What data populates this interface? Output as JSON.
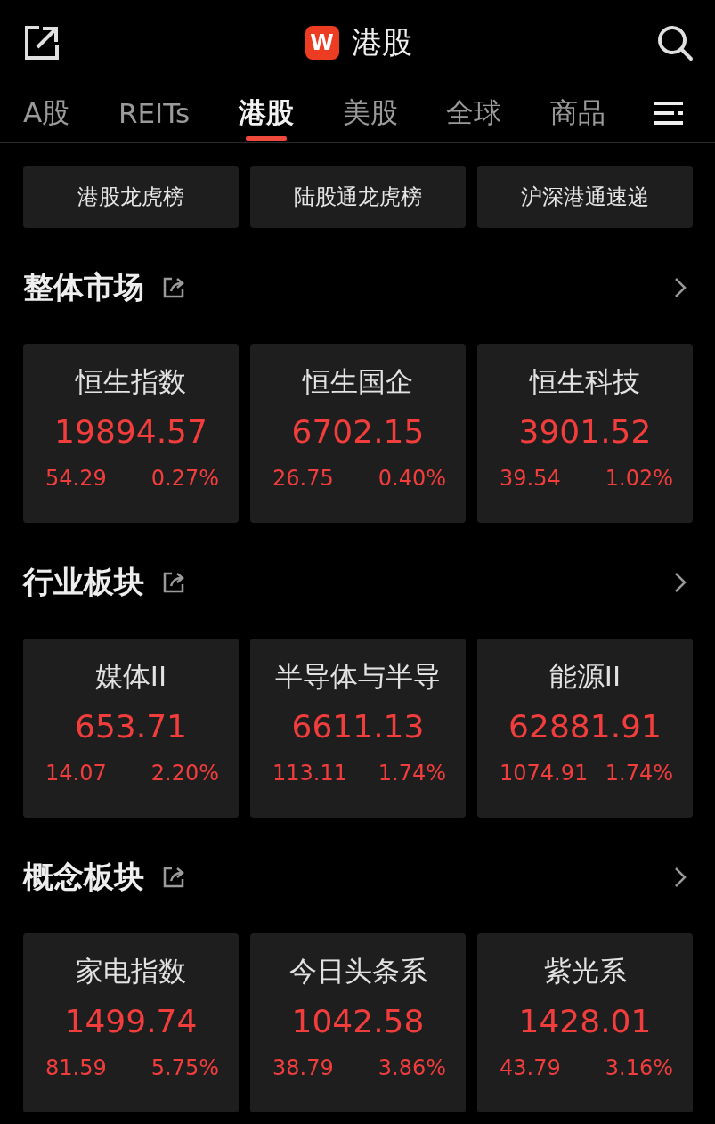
{
  "header": {
    "logo": "W",
    "title": "港股"
  },
  "tabs": [
    {
      "label": "A股",
      "selected": false
    },
    {
      "label": "REITs",
      "selected": false
    },
    {
      "label": "港股",
      "selected": true
    },
    {
      "label": "美股",
      "selected": false
    },
    {
      "label": "全球",
      "selected": false
    },
    {
      "label": "商品",
      "selected": false
    }
  ],
  "quick_links": [
    "港股龙虎榜",
    "陆股通龙虎榜",
    "沪深港通速递"
  ],
  "sections": [
    {
      "title": "整体市场",
      "items": [
        {
          "name": "恒生指数",
          "price": "19894.57",
          "change": "54.29",
          "percent": "0.27%",
          "rising": true
        },
        {
          "name": "恒生国企",
          "price": "6702.15",
          "change": "26.75",
          "percent": "0.40%",
          "rising": true
        },
        {
          "name": "恒生科技",
          "price": "3901.52",
          "change": "39.54",
          "percent": "1.02%",
          "rising": true
        }
      ]
    },
    {
      "title": "行业板块",
      "items": [
        {
          "name": "媒体II",
          "price": "653.71",
          "change": "14.07",
          "percent": "2.20%",
          "rising": true
        },
        {
          "name": "半导体与半导",
          "price": "6611.13",
          "change": "113.11",
          "percent": "1.74%",
          "rising": true
        },
        {
          "name": "能源II",
          "price": "62881.91",
          "change": "1074.91",
          "percent": "1.74%",
          "rising": true
        }
      ]
    },
    {
      "title": "概念板块",
      "items": [
        {
          "name": "家电指数",
          "price": "1499.74",
          "change": "81.59",
          "percent": "5.75%",
          "rising": true
        },
        {
          "name": "今日头条系",
          "price": "1042.58",
          "change": "38.79",
          "percent": "3.86%",
          "rising": true
        },
        {
          "name": "紫光系",
          "price": "1428.01",
          "change": "43.79",
          "percent": "3.16%",
          "rising": true
        }
      ]
    }
  ]
}
